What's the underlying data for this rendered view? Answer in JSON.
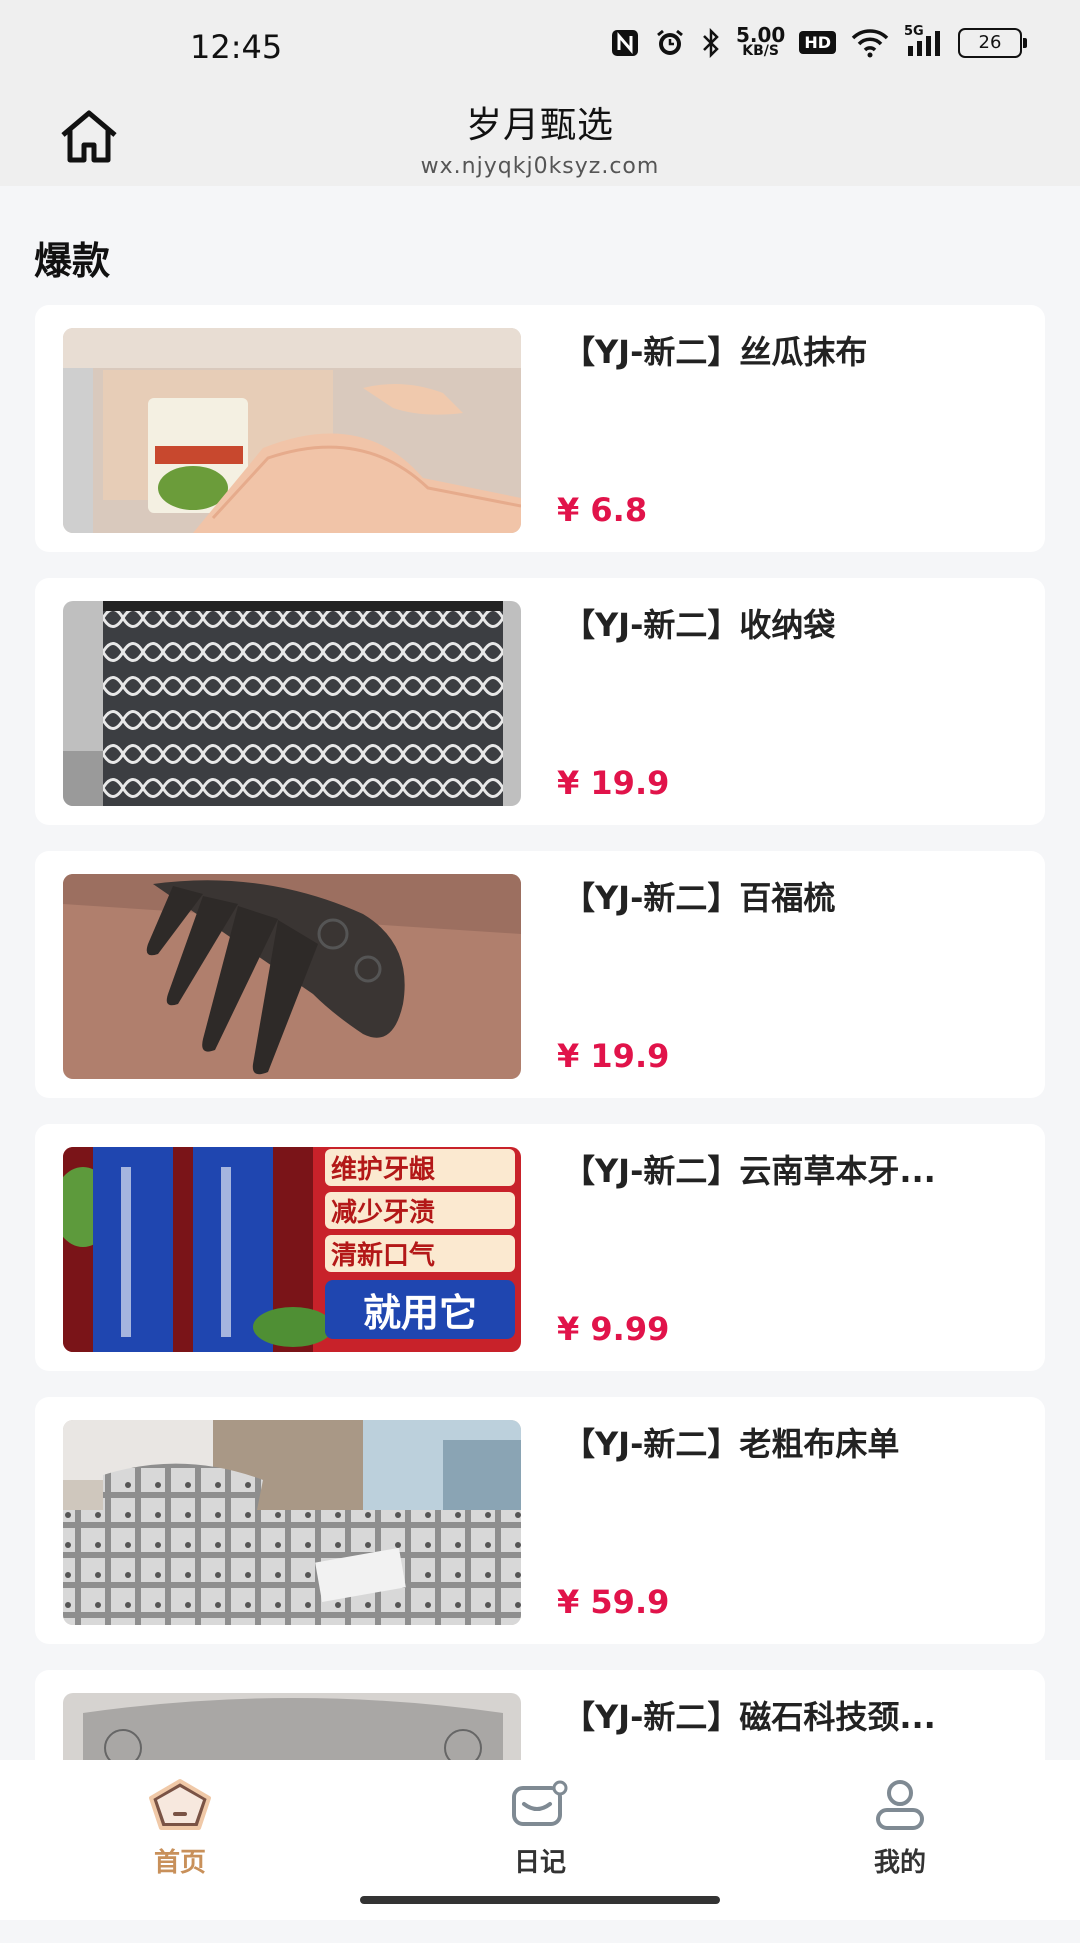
{
  "status_bar": {
    "time": "12:45",
    "speed_value": "5.00",
    "speed_unit": "KB/S",
    "hd": "HD",
    "network": "5G",
    "battery": "26",
    "icons": [
      "nfc-icon",
      "alarm-icon",
      "bluetooth-icon",
      "wifi-icon",
      "signal-icon",
      "battery-icon"
    ]
  },
  "header": {
    "title": "岁月甄选",
    "url": "wx.njyqkj0ksyz.com",
    "home_icon": "home-icon"
  },
  "section": {
    "title": "爆款"
  },
  "products": [
    {
      "title": "【YJ-新二】丝瓜抹布",
      "price": "¥ 6.8"
    },
    {
      "title": "【YJ-新二】收纳袋",
      "price": "¥ 19.9"
    },
    {
      "title": "【YJ-新二】百福梳",
      "price": "¥ 19.9"
    },
    {
      "title": "【YJ-新二】云南草本牙...",
      "price": "¥ 9.99",
      "image_text": [
        "维护牙龈",
        "减少牙渍",
        "清新口气",
        "就用它"
      ]
    },
    {
      "title": "【YJ-新二】老粗布床单",
      "price": "¥ 59.9"
    },
    {
      "title": "【YJ-新二】磁石科技颈..."
    }
  ],
  "tabbar": {
    "items": [
      {
        "label": "首页",
        "icon": "home-pentagon-icon",
        "active": true
      },
      {
        "label": "日记",
        "icon": "diary-icon",
        "active": false
      },
      {
        "label": "我的",
        "icon": "profile-icon",
        "active": false
      }
    ],
    "active_color": "#c8905a"
  },
  "colors": {
    "price": "#e1134a",
    "background": "#f5f6f8"
  }
}
